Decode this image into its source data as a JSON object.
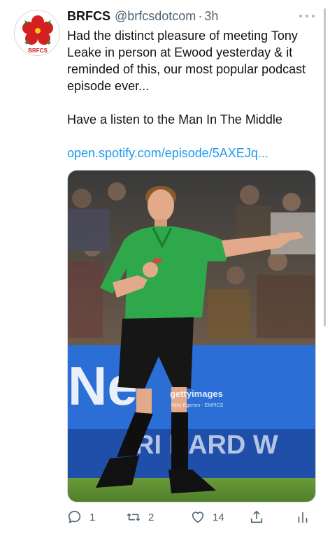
{
  "tweet": {
    "author": {
      "display_name": "BRFCS",
      "handle": "@brfcsdotcom",
      "avatar_text": "BRFCS"
    },
    "separator": "·",
    "timestamp": "3h",
    "text": {
      "paragraph1": "Had the distinct pleasure of meeting Tony Leake in person at Ewood yesterday & it reminded of this, our most popular podcast episode ever...",
      "paragraph2": "Have a listen to the Man In The Middle"
    },
    "link": "open.spotify.com/episode/5AXEJq...",
    "media": {
      "watermark_brand": "gettyimages",
      "watermark_credit": "Mike Egerton - EMPICS",
      "banner_text": "Ne",
      "banner_text_lower": "RI   HARD W"
    },
    "actions": {
      "reply": {
        "icon": "reply-icon",
        "count": "1"
      },
      "retweet": {
        "icon": "retweet-icon",
        "count": "2"
      },
      "like": {
        "icon": "heart-icon",
        "count": "14"
      },
      "share": {
        "icon": "share-icon"
      },
      "analytics": {
        "icon": "analytics-icon"
      }
    },
    "colors": {
      "link": "#1d9bf0",
      "muted": "#536471",
      "referee_shirt": "#2ea84a",
      "banner_blue": "#2b6fd6"
    }
  }
}
